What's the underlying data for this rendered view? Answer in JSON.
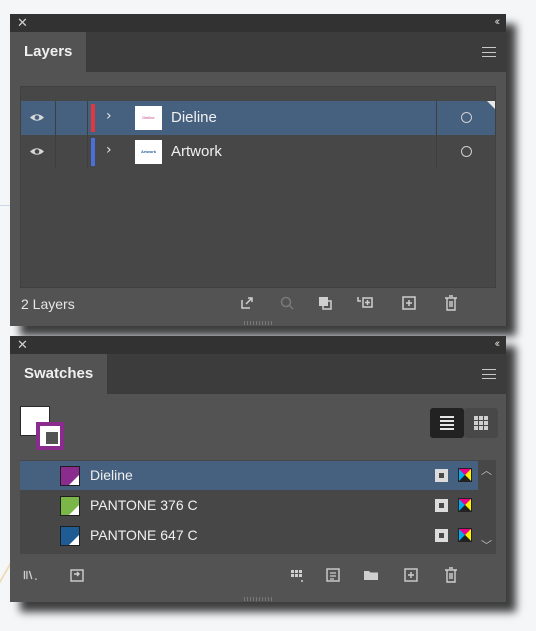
{
  "layers_panel": {
    "tab": "Layers",
    "count_label": "2 Layers",
    "rows": [
      {
        "name": "Dieline",
        "color": "#e0383e",
        "thumb_text": "Dieline",
        "thumb_color": "#c0478a",
        "selected": true
      },
      {
        "name": "Artwork",
        "color": "#4a6fd8",
        "thumb_text": "Artwork",
        "thumb_color": "#2a5fa0",
        "selected": false
      }
    ]
  },
  "swatches_panel": {
    "tab": "Swatches",
    "rows": [
      {
        "name": "Dieline",
        "color": "#8a2b8e",
        "selected": true
      },
      {
        "name": "PANTONE 376 C",
        "color": "#7ab648",
        "selected": false
      },
      {
        "name": "PANTONE 647 C",
        "color": "#1f5c94",
        "selected": false
      }
    ]
  }
}
